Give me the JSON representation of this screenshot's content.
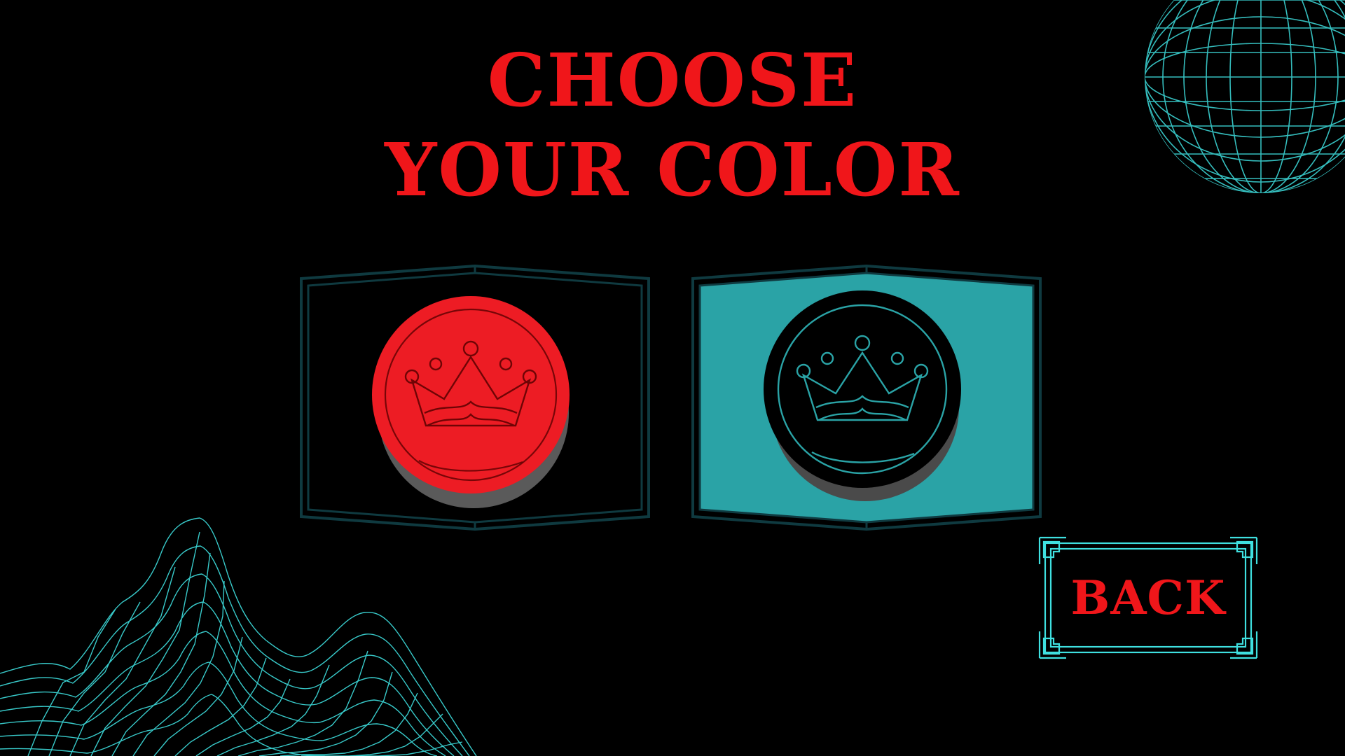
{
  "title": {
    "line1": "CHOOSE",
    "line2": "YOUR COLOR"
  },
  "colors": {
    "background": "#000000",
    "title_red": "#f0161a",
    "checker_red": "#ed1c24",
    "teal": "#2aa3a6",
    "grid_cyan": "#3fe0e0",
    "frame_dark": "#0f3a40"
  },
  "options": [
    {
      "id": "red",
      "icon": "crown-icon",
      "selected": false
    },
    {
      "id": "black",
      "icon": "crown-icon",
      "selected": true
    }
  ],
  "back_button": {
    "label": "BACK"
  },
  "decorations": {
    "top_right": "wireframe-sphere",
    "bottom_left": "wireframe-terrain"
  }
}
